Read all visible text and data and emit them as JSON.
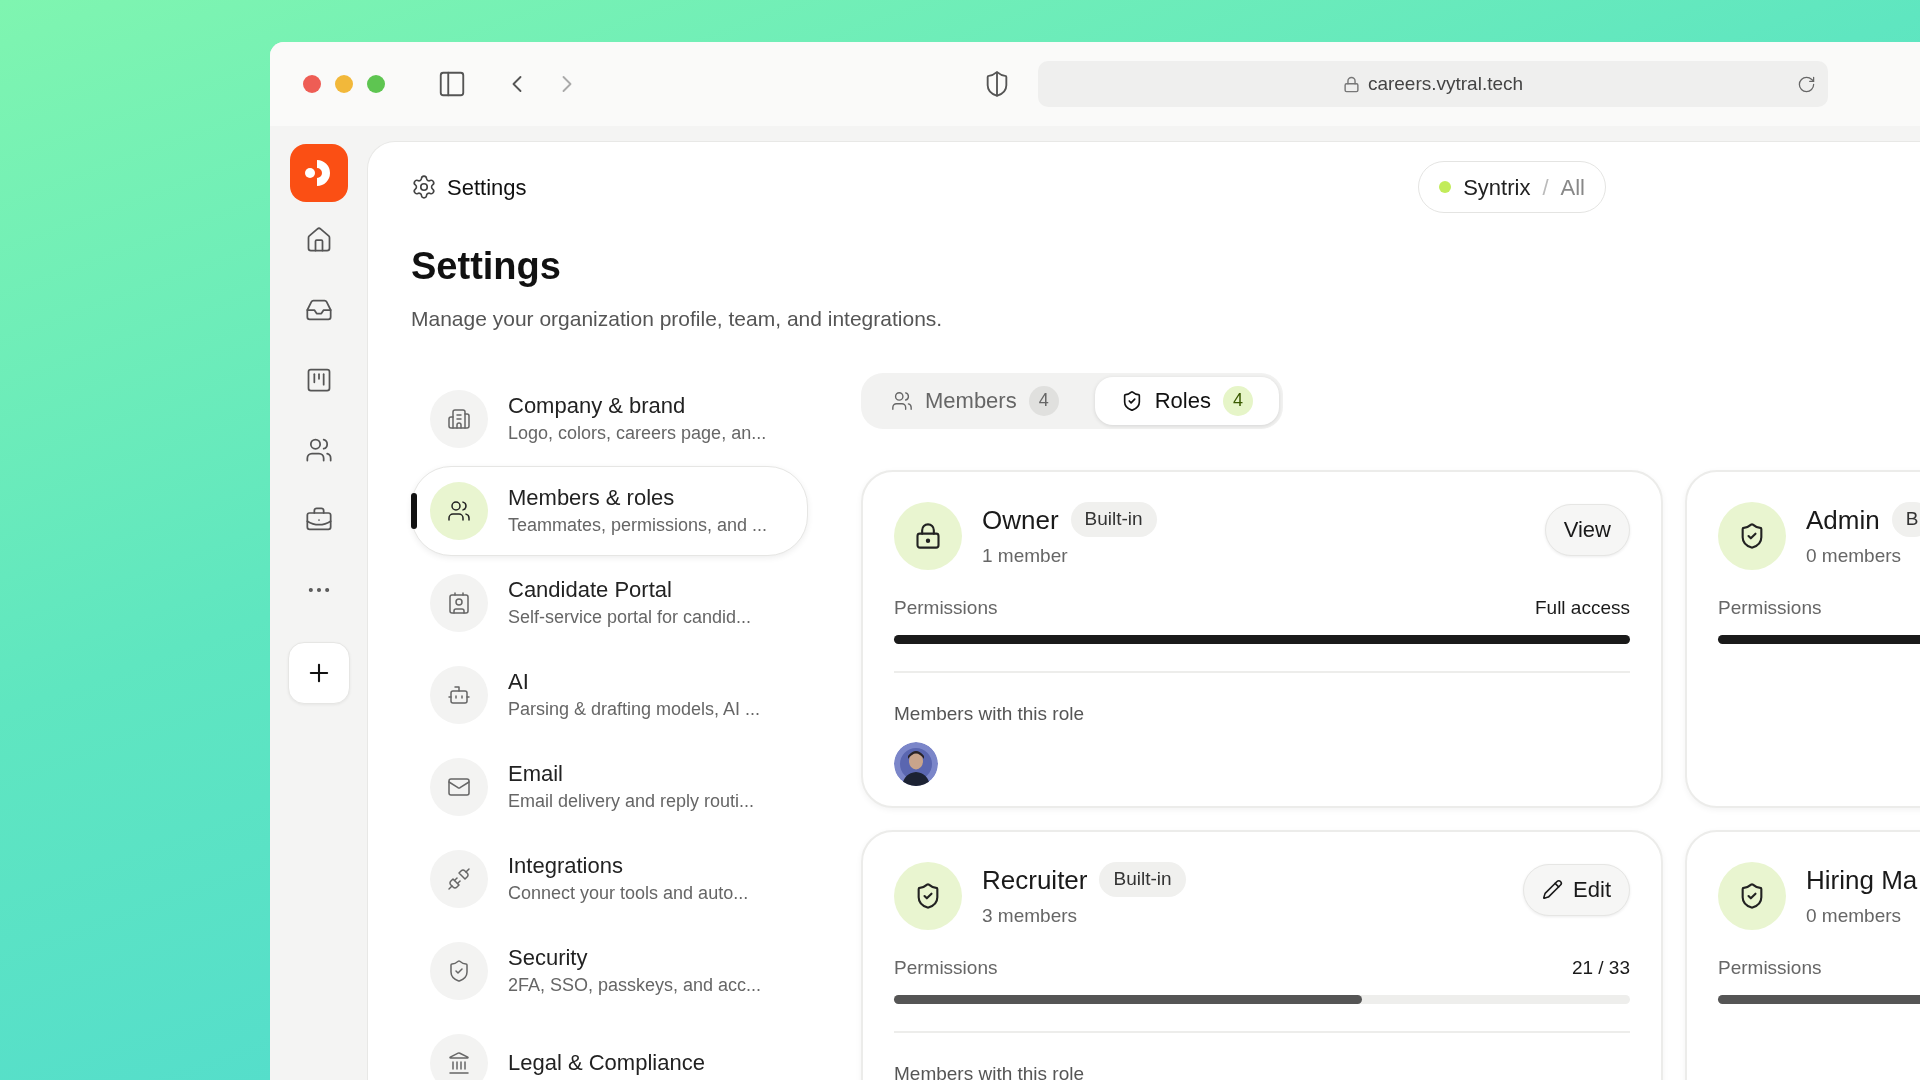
{
  "browser": {
    "url": "careers.vytral.tech"
  },
  "header": {
    "title": "Settings",
    "workspace": "Syntrix",
    "separator": "/",
    "scope": "All"
  },
  "page": {
    "title": "Settings",
    "subtitle": "Manage your organization profile, team, and integrations."
  },
  "nav": [
    {
      "title": "Company & brand",
      "description": "Logo, colors, careers page, an...",
      "selected": false
    },
    {
      "title": "Members & roles",
      "description": "Teammates, permissions, and ...",
      "selected": true
    },
    {
      "title": "Candidate Portal",
      "description": "Self-service portal for candid...",
      "selected": false
    },
    {
      "title": "AI",
      "description": "Parsing & drafting models, AI ...",
      "selected": false
    },
    {
      "title": "Email",
      "description": "Email delivery and reply routi...",
      "selected": false
    },
    {
      "title": "Integrations",
      "description": "Connect your tools and auto...",
      "selected": false
    },
    {
      "title": "Security",
      "description": "2FA, SSO, passkeys, and acc...",
      "selected": false
    },
    {
      "title": "Legal & Compliance",
      "selected": false
    }
  ],
  "tabs": [
    {
      "label": "Members",
      "count": "4",
      "selected": false
    },
    {
      "label": "Roles",
      "count": "4",
      "selected": true
    }
  ],
  "roles": [
    {
      "kind": "locked",
      "name": "Owner",
      "badge": "Built-in",
      "members": "1 member",
      "permissions_label": "Permissions",
      "access": "Full access",
      "level": 1,
      "action": {
        "kind": "view",
        "label": "View"
      },
      "members_heading": "Members with this role",
      "avatars": [
        {
          "kind": "picture"
        }
      ]
    },
    {
      "kind": "shield",
      "name": "Admin",
      "badge": "B",
      "members": "0 members",
      "permissions_label": "Permissions",
      "level": 1
    },
    {
      "kind": "shield",
      "name": "Recruiter",
      "badge": "Built-in",
      "members": "3 members",
      "permissions_label": "Permissions",
      "access": "21 / 33",
      "level": 0.636,
      "action": {
        "kind": "edit",
        "label": "Edit"
      },
      "members_heading": "Members with this role"
    },
    {
      "kind": "shield",
      "name": "Hiring Ma",
      "members": "0 members",
      "permissions_label": "Permissions",
      "level": 0.6
    }
  ]
}
